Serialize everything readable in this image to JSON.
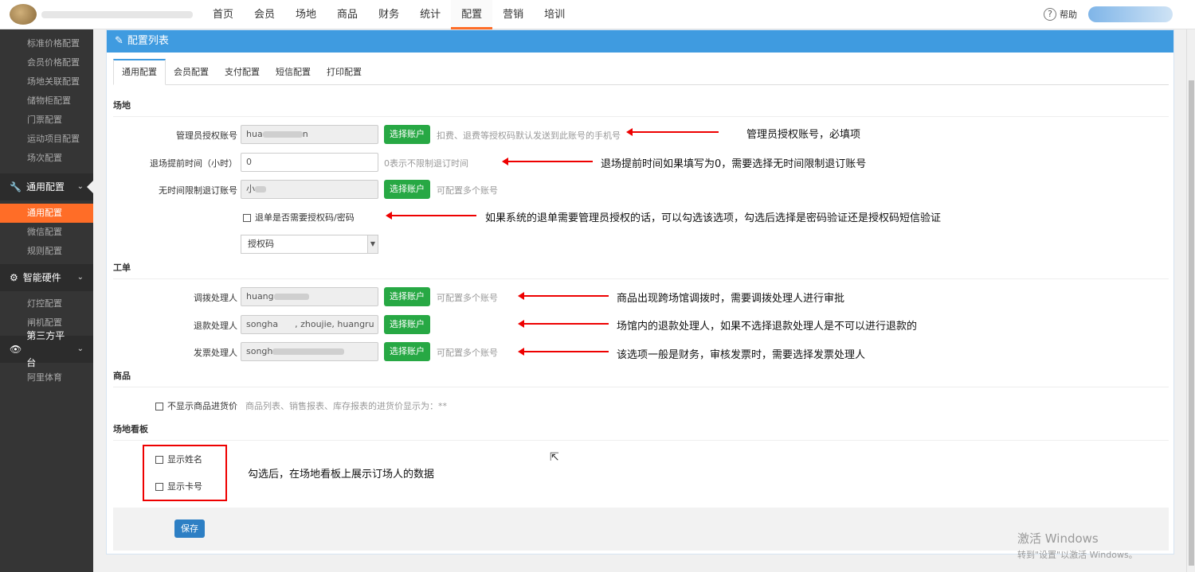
{
  "topnav": {
    "items": [
      "首页",
      "会员",
      "场地",
      "商品",
      "财务",
      "统计",
      "配置",
      "营销",
      "培训"
    ],
    "active_index": 6,
    "help_label": "帮助",
    "help_icon": "question-circle-icon"
  },
  "sidebar": {
    "top_items": [
      "标准价格配置",
      "会员价格配置",
      "场地关联配置",
      "储物柜配置",
      "门票配置",
      "运动项目配置",
      "场次配置"
    ],
    "groups": [
      {
        "label": "通用配置",
        "icon": "wrench-icon",
        "items": [
          "通用配置",
          "微信配置",
          "规则配置"
        ],
        "active_item": 0
      },
      {
        "label": "智能硬件",
        "icon": "gear-icon",
        "items": [
          "灯控配置",
          "闸机配置"
        ]
      },
      {
        "label": "第三方平台",
        "icon": "eye-icon",
        "items": [
          "阿里体育"
        ]
      }
    ]
  },
  "panel": {
    "title": "配置列表",
    "tabs": [
      "通用配置",
      "会员配置",
      "支付配置",
      "短信配置",
      "打印配置"
    ],
    "active_tab": 0
  },
  "venue": {
    "section": "场地",
    "admin_account": {
      "label": "管理员授权账号",
      "value_prefix": "hua",
      "value_suffix": "n",
      "button": "选择账户",
      "hint": "扣费、退费等授权码默认发送到此账号的手机号"
    },
    "refund_hours": {
      "label": "退场提前时间（小时）",
      "value": "0",
      "hint": "0表示不限制退订时间"
    },
    "unlimited_account": {
      "label": "无时间限制退订账号",
      "value_prefix": "小",
      "button": "选择账户",
      "hint": "可配置多个账号"
    },
    "need_auth": {
      "label": "退单是否需要授权码/密码"
    },
    "auth_select": {
      "value": "授权码"
    }
  },
  "workorder": {
    "section": "工单",
    "transfer": {
      "label": "调拨处理人",
      "value_prefix": "huang",
      "button": "选择账户",
      "hint": "可配置多个账号"
    },
    "refund": {
      "label": "退款处理人",
      "value": "songha      , zhoujie, huangru",
      "button": "选择账户"
    },
    "invoice": {
      "label": "发票处理人",
      "value_prefix": "songh",
      "button": "选择账户",
      "hint": "可配置多个账号"
    }
  },
  "goods": {
    "section": "商品",
    "hide_cost": {
      "label": "不显示商品进货价",
      "hint": "商品列表、销售报表、库存报表的进货价显示为：**"
    }
  },
  "board": {
    "section": "场地看板",
    "show_name": "显示姓名",
    "show_card": "显示卡号"
  },
  "footer": {
    "save": "保存"
  },
  "annotations": {
    "admin": "管理员授权账号，必填项",
    "refund_time": "退场提前时间如果填写为0，需要选择无时间限制退订账号",
    "auth": "如果系统的退单需要管理员授权的话，可以勾选该选项，勾选后选择是密码验证还是授权码短信验证",
    "transfer": "商品出现跨场馆调拨时，需要调拨处理人进行审批",
    "refund": "场馆内的退款处理人，如果不选择退款处理人是不可以进行退款的",
    "invoice": "该选项一般是财务，审核发票时，需要选择发票处理人",
    "board": "勾选后，在场地看板上展示订场人的数据"
  },
  "watermark": {
    "line1": "激活 Windows",
    "line2": "转到\"设置\"以激活 Windows。"
  },
  "colors": {
    "accent": "#ff6d27",
    "header_blue": "#3f9be0",
    "green": "#27a844",
    "annotation_red": "#ee0000"
  }
}
